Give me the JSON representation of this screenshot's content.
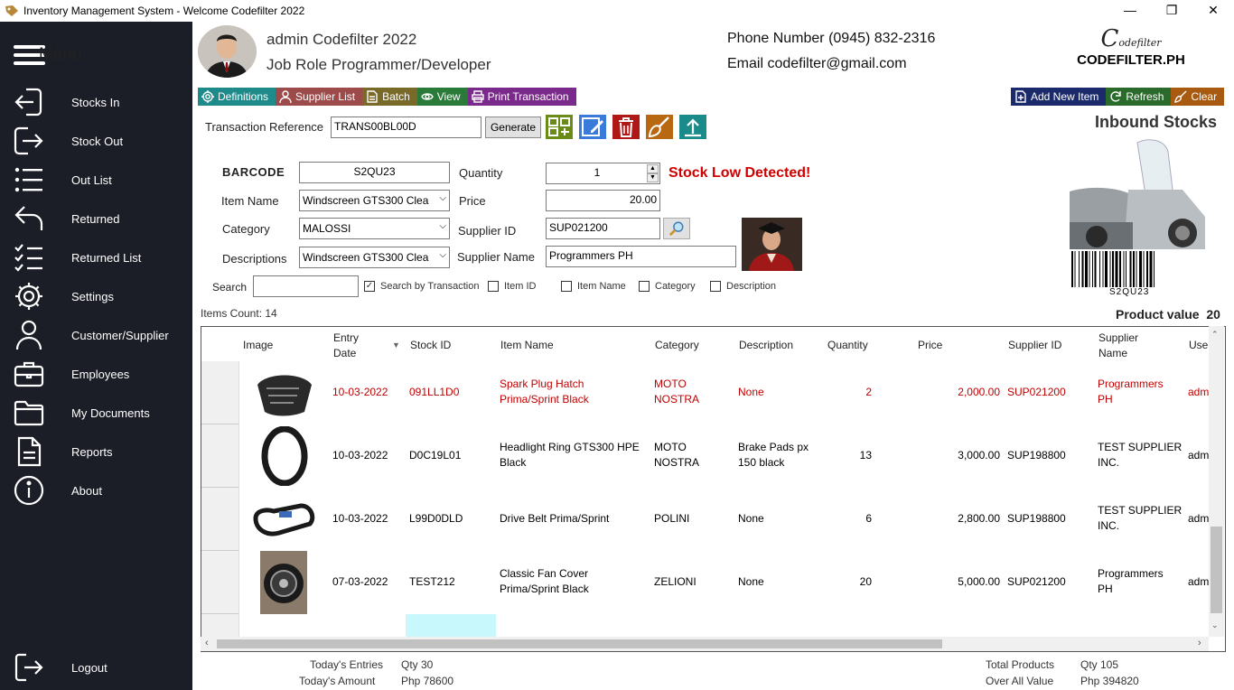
{
  "window": {
    "title": "Inventory Management System - Welcome Codefilter 2022",
    "minimize": "—",
    "restore": "❐",
    "close": "✕"
  },
  "sidebar": {
    "menu_label": "Menu",
    "items": [
      {
        "label": "Stocks In",
        "icon": "sign-in-icon"
      },
      {
        "label": "Stock Out",
        "icon": "sign-out-icon"
      },
      {
        "label": "Out List",
        "icon": "list-icon"
      },
      {
        "label": "Returned",
        "icon": "return-arrow-icon"
      },
      {
        "label": "Returned List",
        "icon": "checklist-icon"
      },
      {
        "label": "Settings",
        "icon": "gear-icon"
      },
      {
        "label": "Customer/Supplier",
        "icon": "user-icon"
      },
      {
        "label": "Employees",
        "icon": "briefcase-icon"
      },
      {
        "label": "My Documents",
        "icon": "folder-icon"
      },
      {
        "label": "Reports",
        "icon": "document-icon"
      },
      {
        "label": "About",
        "icon": "info-icon"
      }
    ],
    "logout": "Logout"
  },
  "header": {
    "name": "admin Codefilter 2022",
    "role": "Job Role Programmer/Developer",
    "phone": "Phone Number (0945) 832-2316",
    "email": "Email codefilter@gmail.com",
    "logo_text": "CODEFILTER.PH",
    "logo_script": "odefilter"
  },
  "toolbar": {
    "definitions": "Definitions",
    "supplier_list": "Supplier List",
    "batch": "Batch",
    "view": "View",
    "print": "Print Transaction",
    "add_new": "Add New Item",
    "refresh": "Refresh",
    "clear": "Clear",
    "colors": {
      "definitions": "#1f8a8a",
      "supplier": "#9c4a4a",
      "batch": "#7a6a2a",
      "view": "#2a7a3a",
      "print": "#7a2a8a",
      "add": "#1b2a6a",
      "refresh": "#2a6a2a",
      "clear": "#a85a10"
    }
  },
  "form": {
    "transaction_label": "Transaction Reference",
    "transaction_value": "TRANS00BL00D",
    "generate": "Generate",
    "barcode_label": "BARCODE",
    "barcode_value": "S2QU23",
    "quantity_label": "Quantity",
    "quantity_value": "1",
    "item_name_label": "Item Name",
    "item_name_value": "Windscreen GTS300 Clea",
    "price_label": "Price",
    "price_value": "20.00",
    "category_label": "Category",
    "category_value": "MALOSSI",
    "supplier_id_label": "Supplier ID",
    "supplier_id_value": "SUP021200",
    "descriptions_label": "Descriptions",
    "descriptions_value": "Windscreen GTS300 Clea",
    "supplier_name_label": "Supplier Name",
    "supplier_name_value": "Programmers PH",
    "stock_low": "Stock Low Detected!",
    "search_label": "Search",
    "search_value": "",
    "checks": [
      {
        "label": "Search by Transaction",
        "checked": true
      },
      {
        "label": "Item ID",
        "checked": false
      },
      {
        "label": "Item Name",
        "checked": false
      },
      {
        "label": "Category",
        "checked": false
      },
      {
        "label": "Description",
        "checked": false
      }
    ]
  },
  "panel": {
    "title": "Inbound Stocks",
    "barcode_text": "S2QU23",
    "product_value_label": "Product value",
    "product_value": "20"
  },
  "items_count": "Items Count: 14",
  "grid": {
    "headers": [
      "Image",
      "Entry Date",
      "Stock ID",
      "Item Name",
      "Category",
      "Description",
      "Quantity",
      "Price",
      "Supplier ID",
      "Supplier Name",
      "Use"
    ],
    "rows": [
      {
        "date": "10-03-2022",
        "stock_id": "091LL1D0",
        "item": "Spark Plug Hatch Prima/Sprint Black",
        "category": "MOTO NOSTRA",
        "desc": "None",
        "qty": "2",
        "price": "2,000.00",
        "supplier_id": "SUP021200",
        "supplier": "Programmers PH",
        "user": "adm",
        "highlight": true
      },
      {
        "date": "10-03-2022",
        "stock_id": "D0C19L01",
        "item": "Headlight Ring GTS300 HPE Black",
        "category": "MOTO NOSTRA",
        "desc": "Brake Pads px 150 black",
        "qty": "13",
        "price": "3,000.00",
        "supplier_id": "SUP198800",
        "supplier": "TEST SUPPLIER INC.",
        "user": "adm",
        "highlight": false
      },
      {
        "date": "10-03-2022",
        "stock_id": "L99D0DLD",
        "item": "Drive Belt Prima/Sprint",
        "category": "POLINI",
        "desc": "None",
        "qty": "6",
        "price": "2,800.00",
        "supplier_id": "SUP198800",
        "supplier": "TEST SUPPLIER INC.",
        "user": "adm",
        "highlight": false
      },
      {
        "date": "07-03-2022",
        "stock_id": "TEST212",
        "item": "Classic Fan Cover Prima/Sprint Black",
        "category": "ZELIONI",
        "desc": "None",
        "qty": "20",
        "price": "5,000.00",
        "supplier_id": "SUP021200",
        "supplier": "Programmers PH",
        "user": "adm",
        "highlight": false
      }
    ]
  },
  "footer": {
    "today_entries_label": "Today's Entries",
    "today_entries": "Qty 30",
    "today_amount_label": "Today's Amount",
    "today_amount": "Php 78600",
    "total_products_label": "Total Products",
    "total_products": "Qty 105",
    "overall_label": "Over All Value",
    "overall": "Php 394820"
  }
}
